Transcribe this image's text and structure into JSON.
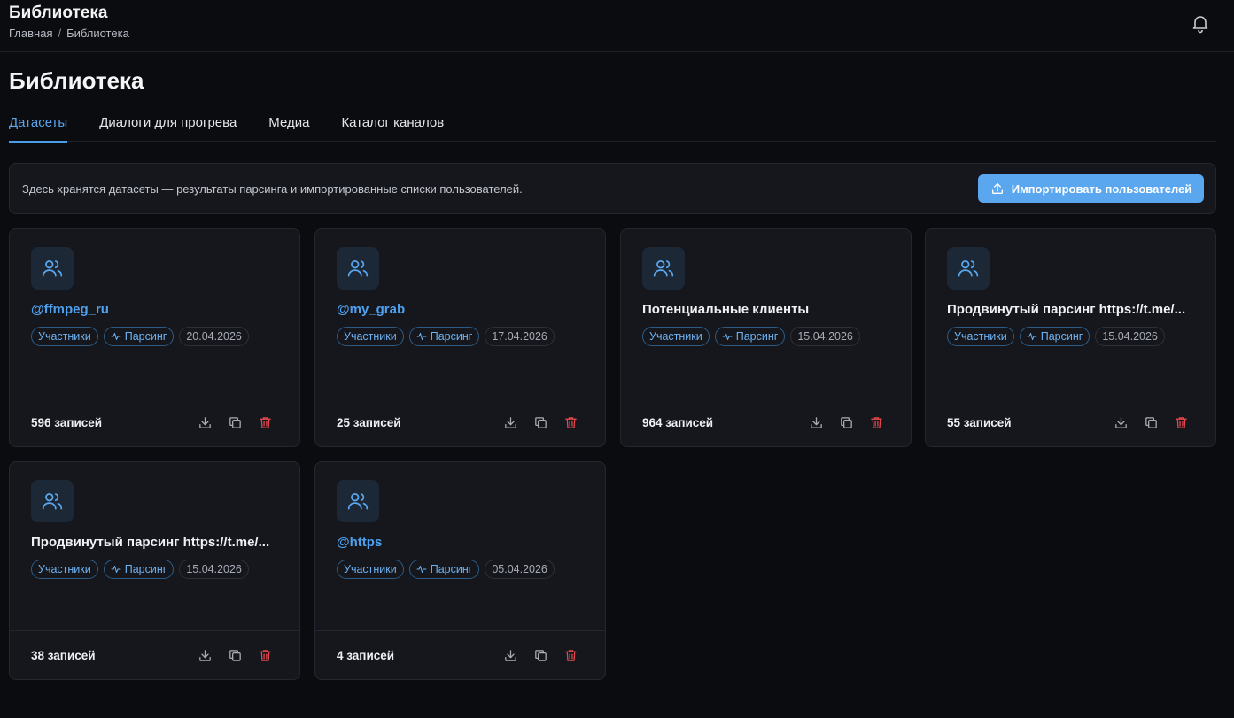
{
  "header": {
    "title": "Библиотека",
    "breadcrumb": [
      "Главная",
      "/",
      "Библиотека"
    ]
  },
  "page": {
    "title": "Библиотека"
  },
  "tabs": [
    {
      "label": "Датасеты",
      "active": true
    },
    {
      "label": "Диалоги для прогрева",
      "active": false
    },
    {
      "label": "Медиа",
      "active": false
    },
    {
      "label": "Каталог каналов",
      "active": false
    }
  ],
  "info": {
    "description": "Здесь хранятся датасеты — результаты парсинга и импортированные списки пользователей.",
    "import_label": "Импортировать пользователей"
  },
  "colors": {
    "accent": "#5aa7ef",
    "danger": "#e5484d",
    "link": "#4fa0ee"
  },
  "datasets": [
    {
      "name": "@ffmpeg_ru",
      "is_link": true,
      "type_label": "Участники",
      "source_label": "Парсинг",
      "date": "20.04.2026",
      "count": "596 записей"
    },
    {
      "name": "@my_grab",
      "is_link": true,
      "type_label": "Участники",
      "source_label": "Парсинг",
      "date": "17.04.2026",
      "count": "25 записей"
    },
    {
      "name": "Потенциальные клиенты",
      "is_link": false,
      "type_label": "Участники",
      "source_label": "Парсинг",
      "date": "15.04.2026",
      "count": "964 записей"
    },
    {
      "name": "Продвинутый парсинг https://t.me/...",
      "is_link": false,
      "type_label": "Участники",
      "source_label": "Парсинг",
      "date": "15.04.2026",
      "count": "55 записей"
    },
    {
      "name": "Продвинутый парсинг https://t.me/...",
      "is_link": false,
      "type_label": "Участники",
      "source_label": "Парсинг",
      "date": "15.04.2026",
      "count": "38 записей"
    },
    {
      "name": "@https",
      "is_link": true,
      "type_label": "Участники",
      "source_label": "Парсинг",
      "date": "05.04.2026",
      "count": "4 записей"
    }
  ]
}
